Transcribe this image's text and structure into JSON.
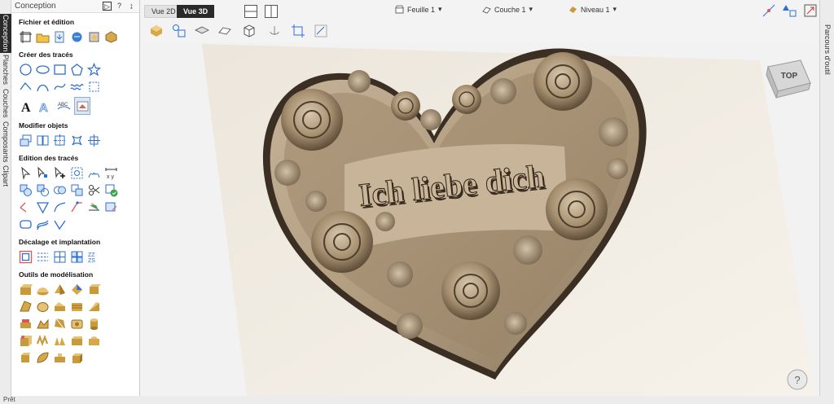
{
  "left_tabs": [
    "Conception",
    "Planches",
    "Couches",
    "Composants",
    "Clipart"
  ],
  "panel": {
    "title": "Conception",
    "pin_label": "⊟",
    "help_label": "?",
    "sections": [
      {
        "title": "Fichier et édition"
      },
      {
        "title": "Créer des tracés"
      },
      {
        "title": "Modifier objets"
      },
      {
        "title": "Edition des tracés"
      },
      {
        "title": "Décalage et implantation"
      },
      {
        "title": "Outils de modélisation"
      }
    ]
  },
  "topbar": {
    "tab_2d": "Vue 2D",
    "tab_3d": "Vue 3D",
    "sheet": "Feuille 1",
    "layer": "Couche 1",
    "level": "Niveau 1"
  },
  "viewport": {
    "model_text": "Ich liebe dich",
    "cube_label": "TOP",
    "help_label": "?"
  },
  "right_tab": "Parcours d'outil",
  "status": "Prêt"
}
